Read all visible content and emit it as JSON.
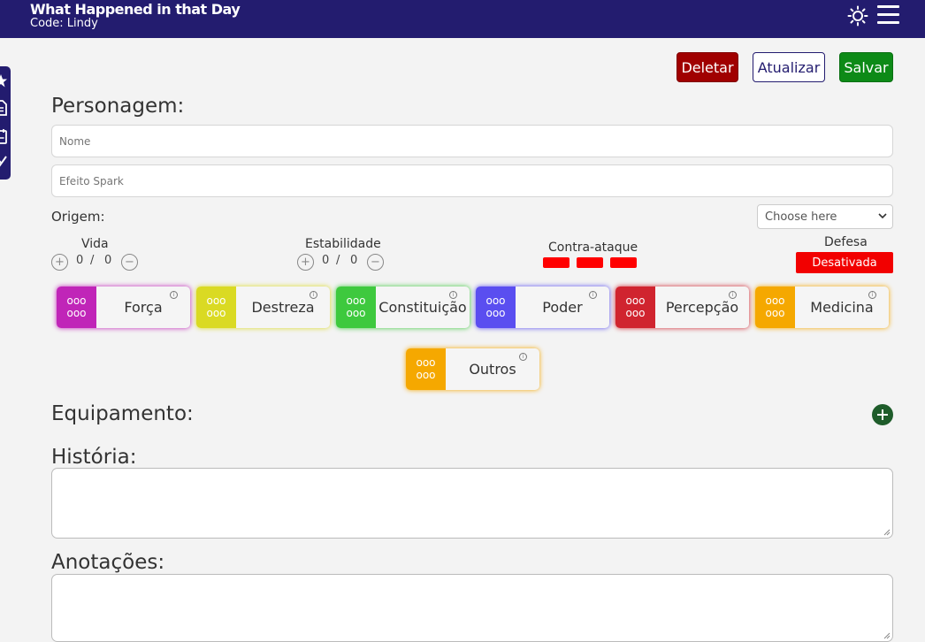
{
  "header": {
    "title": "What Happened in that Day",
    "code": "Code: Lindy"
  },
  "actions": {
    "delete": "Deletar",
    "update": "Atualizar",
    "save": "Salvar"
  },
  "character": {
    "heading": "Personagem:",
    "name_placeholder": "Nome",
    "spark_placeholder": "Efeito Spark",
    "origin_label": "Origem:",
    "origin_select": "Choose here"
  },
  "stats": {
    "vida": {
      "label": "Vida",
      "current": "0",
      "max": "0"
    },
    "estabilidade": {
      "label": "Estabilidade",
      "current": "0",
      "max": "0"
    },
    "contra_ataque": {
      "label": "Contra-ataque"
    },
    "defesa": {
      "label": "Defesa",
      "status": "Desativada"
    }
  },
  "attributes": [
    {
      "name": "Força",
      "dots": "ooo ooo",
      "color": "#c025b8"
    },
    {
      "name": "Destreza",
      "dots": "ooo ooo",
      "color": "#dada23"
    },
    {
      "name": "Constituição",
      "dots": "ooo ooo",
      "color": "#3ec93e"
    },
    {
      "name": "Poder",
      "dots": "ooo ooo",
      "color": "#5a4ef0"
    },
    {
      "name": "Percepção",
      "dots": "ooo ooo",
      "color": "#d0242f"
    },
    {
      "name": "Medicina",
      "dots": "ooo ooo",
      "color": "#f5a800"
    },
    {
      "name": "Outros",
      "dots": "ooo ooo",
      "color": "#f5a800"
    }
  ],
  "sections": {
    "equipment": "Equipamento:",
    "history": "História:",
    "notes": "Anotações:"
  },
  "colors": {
    "brand": "#231c6f",
    "delete": "#a00000",
    "save": "#0d8a17",
    "alert": "#f20000"
  }
}
